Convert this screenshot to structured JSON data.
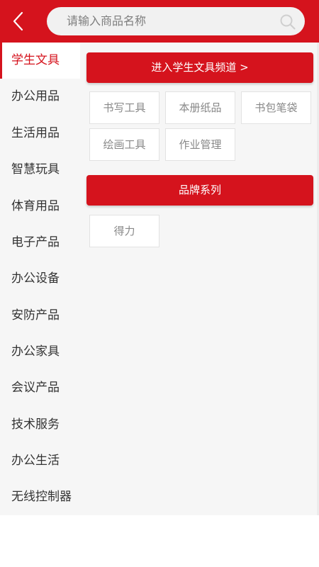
{
  "search": {
    "placeholder": "请输入商品名称"
  },
  "sidebar": {
    "items": [
      {
        "label": "学生文具",
        "active": true
      },
      {
        "label": "办公用品"
      },
      {
        "label": "生活用品"
      },
      {
        "label": "智慧玩具"
      },
      {
        "label": "体育用品"
      },
      {
        "label": "电子产品"
      },
      {
        "label": "办公设备"
      },
      {
        "label": "安防产品"
      },
      {
        "label": "办公家具"
      },
      {
        "label": "会议产品"
      },
      {
        "label": "技术服务"
      },
      {
        "label": "办公生活"
      },
      {
        "label": "无线控制器"
      }
    ]
  },
  "main": {
    "channel_button": "进入学生文具频道 >",
    "categories": [
      "书写工具",
      "本册纸品",
      "书包笔袋",
      "绘画工具",
      "作业管理"
    ],
    "brand_header": "品牌系列",
    "brands": [
      "得力"
    ]
  },
  "colors": {
    "accent": "#d5131d",
    "sidebar_bg": "#f6f6f6",
    "tag_border": "#e2e2e2"
  },
  "icons": {
    "back": "chevron-left-icon",
    "search": "search-icon"
  }
}
